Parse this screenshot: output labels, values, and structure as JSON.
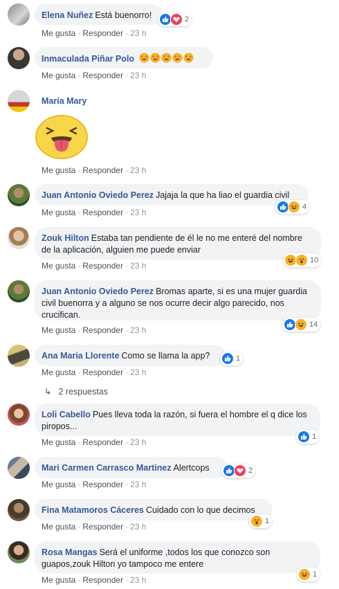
{
  "actions": {
    "like": "Me gusta",
    "reply": "Responder",
    "sep": "·"
  },
  "comments": [
    {
      "name": "Elena Nuñez",
      "text": "Está buenorro!",
      "time": "23 h",
      "reactions": [
        "like-icon",
        "love-icon"
      ],
      "count": "2"
    },
    {
      "name": "Inmaculada Piñar Polo",
      "text": "",
      "time": "23 h",
      "emojis": [
        "heart-eyes-icon",
        "heart-eyes-icon",
        "heart-eyes-icon",
        "heart-eyes-icon",
        "heart-eyes-icon"
      ]
    },
    {
      "name": "Maria Mary",
      "text": "",
      "time": "23 h",
      "sticker": "tongue-out-sticker"
    },
    {
      "name": "Juan Antonio Oviedo Perez",
      "text": "Jajaja la que ha liao el guardia civil",
      "time": "23 h",
      "reactions": [
        "like-icon",
        "haha-icon"
      ],
      "count": "4"
    },
    {
      "name": "Zouk Hilton",
      "text": "Estaba tan pendiente de él le no me enteré del nombre de la aplicación, alguien me puede enviar",
      "time": "23 h",
      "reactions": [
        "haha-icon",
        "wow-icon"
      ],
      "count": "10"
    },
    {
      "name": "Juan Antonio Oviedo Perez",
      "text": "Bromas aparte, si es una mujer guardia civil buenorra y a alguno se nos ocurre decir algo parecido, nos crucifican.",
      "time": "23 h",
      "reactions": [
        "like-icon",
        "haha-icon"
      ],
      "count": "14"
    },
    {
      "name": "Ana Maria Llorente",
      "text": "Como se llama la app?",
      "time": "23 h",
      "reactions": [
        "like-icon"
      ],
      "count": "1",
      "replies": "2 respuestas"
    },
    {
      "name": "Loli Cabello",
      "text": "Pues lleva toda la razón, si fuera el hombre el q dice los piropos...",
      "time": "23 h",
      "reactions": [
        "like-icon"
      ],
      "count": "1"
    },
    {
      "name": "Mari Carmen Carrasco Martinez",
      "text": "Alertcops",
      "time": "23 h",
      "reactions": [
        "like-icon",
        "love-icon"
      ],
      "count": "2"
    },
    {
      "name": "Fina Matamoros Cáceres",
      "text": "Cuidado con lo que decimos",
      "time": "23 h",
      "reactions": [
        "wow-icon"
      ],
      "count": "1"
    },
    {
      "name": "Rosa Mangas",
      "text": "Será el uniforme ,todos los que conozco son guapos,zouk Hilton yo tampoco me entere",
      "time": "23 h",
      "reactions": [
        "haha-icon"
      ],
      "count": "1"
    }
  ],
  "colors": {
    "name": "#385898",
    "bubble": "#f2f3f5",
    "like": "#1877f2",
    "love": "#f33e58",
    "emoji": "#f7b125"
  }
}
